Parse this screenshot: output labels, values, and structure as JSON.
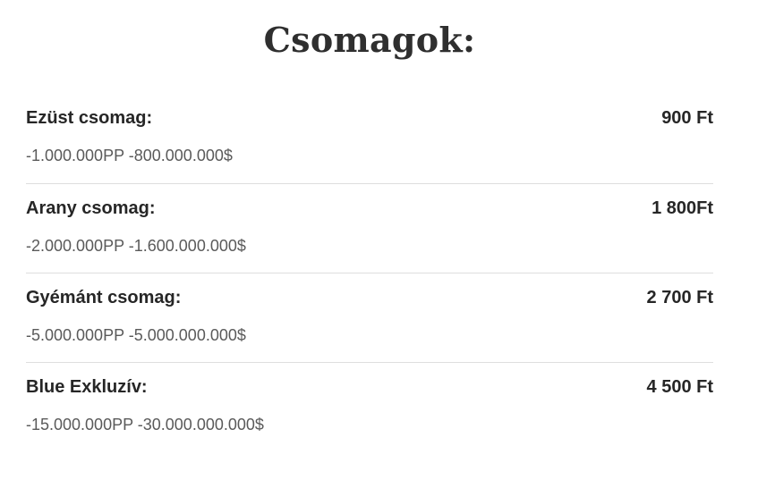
{
  "header": {
    "title": "Csomagok:"
  },
  "packages": [
    {
      "name": "Ezüst csomag:",
      "price": "900 Ft",
      "description": "-1.000.000PP -800.000.000$"
    },
    {
      "name": "Arany csomag:",
      "price": "1 800Ft",
      "description": "-2.000.000PP -1.600.000.000$"
    },
    {
      "name": "Gyémánt csomag:",
      "price": "2 700 Ft",
      "description": "-5.000.000PP -5.000.000.000$"
    },
    {
      "name": "Blue Exkluzív:",
      "price": "4 500 Ft",
      "description": "-15.000.000PP -30.000.000.000$"
    }
  ]
}
